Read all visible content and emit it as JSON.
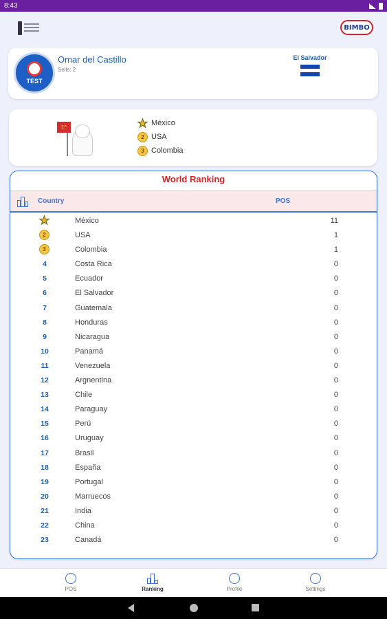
{
  "status_bar": {
    "time": "8:43"
  },
  "header": {
    "brand_right": "BIMBO"
  },
  "profile": {
    "name": "Omar del Castillo",
    "sells": "Sells: 2",
    "badge_text": "TEST",
    "country": "El Salvador",
    "flag_colors": [
      "#0f47af",
      "#ffffff",
      "#0f47af"
    ]
  },
  "podium": {
    "pennant": "1°",
    "items": [
      {
        "medal": "star-gold-icon",
        "name": "México"
      },
      {
        "medal": "medal-2-icon",
        "name": "USA"
      },
      {
        "medal": "medal-3-icon",
        "name": "Colombia"
      }
    ]
  },
  "ranking": {
    "title": "World Ranking",
    "col_country": "Country",
    "col_pos": "POS",
    "rows": [
      {
        "rank": "",
        "medal": "star",
        "name": "México",
        "pos": "11"
      },
      {
        "rank": "2",
        "medal": "medal",
        "name": "USA",
        "pos": "1"
      },
      {
        "rank": "3",
        "medal": "medal",
        "name": "Colombia",
        "pos": "1"
      },
      {
        "rank": "4",
        "name": "Costa Rica",
        "pos": "0"
      },
      {
        "rank": "5",
        "name": "Ecuador",
        "pos": "0"
      },
      {
        "rank": "6",
        "name": "El Salvador",
        "pos": "0"
      },
      {
        "rank": "7",
        "name": "Guatemala",
        "pos": "0"
      },
      {
        "rank": "8",
        "name": "Honduras",
        "pos": "0"
      },
      {
        "rank": "9",
        "name": "Nicaragua",
        "pos": "0"
      },
      {
        "rank": "10",
        "name": "Panamá",
        "pos": "0"
      },
      {
        "rank": "11",
        "name": "Venezuela",
        "pos": "0"
      },
      {
        "rank": "12",
        "name": "Argnentina",
        "pos": "0"
      },
      {
        "rank": "13",
        "name": "Chile",
        "pos": "0"
      },
      {
        "rank": "14",
        "name": "Paraguay",
        "pos": "0"
      },
      {
        "rank": "15",
        "name": "Perú",
        "pos": "0"
      },
      {
        "rank": "16",
        "name": "Uruguay",
        "pos": "0"
      },
      {
        "rank": "17",
        "name": "Brasil",
        "pos": "0"
      },
      {
        "rank": "18",
        "name": "España",
        "pos": "0"
      },
      {
        "rank": "19",
        "name": "Portugal",
        "pos": "0"
      },
      {
        "rank": "20",
        "name": "Marruecos",
        "pos": "0"
      },
      {
        "rank": "21",
        "name": "India",
        "pos": "0"
      },
      {
        "rank": "22",
        "name": "China",
        "pos": "0"
      },
      {
        "rank": "23",
        "name": "Canadá",
        "pos": "0"
      }
    ]
  },
  "bottom_nav": {
    "items": [
      {
        "label": "POS",
        "icon": "target-icon"
      },
      {
        "label": "Ranking",
        "icon": "ranking-icon",
        "active": true
      },
      {
        "label": "Profile",
        "icon": "profile-icon"
      },
      {
        "label": "Settings",
        "icon": "gear-icon"
      }
    ]
  },
  "colors": {
    "accent": "#3e73d6",
    "title_red": "#d02525",
    "status_bar": "#6a1fa0"
  }
}
